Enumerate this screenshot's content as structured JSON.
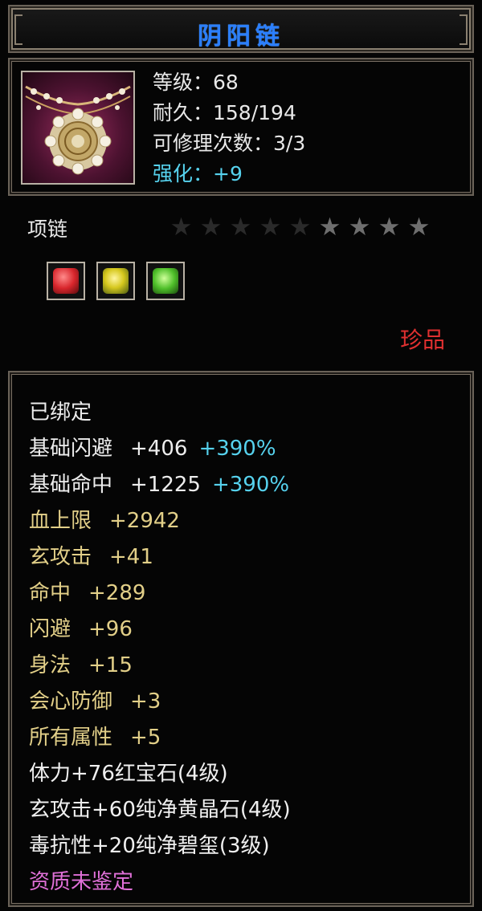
{
  "item": {
    "name": "阴阳链",
    "level_text": "等级：68",
    "durability_text": "耐久：158/194",
    "repair_text": "可修理次数：3/3",
    "enhance_text": "强化：+9",
    "type": "项链",
    "rarity": "珍品",
    "stars": {
      "total": 9,
      "dim": 5,
      "lit": 4
    },
    "gem_sockets": [
      {
        "name": "red-gem-icon",
        "color": "#d8262c"
      },
      {
        "name": "yellow-gem-icon",
        "color": "#d6c81e"
      },
      {
        "name": "green-gem-icon",
        "color": "#4fbf2a"
      }
    ]
  },
  "attributes": {
    "bound": "已绑定",
    "base": [
      {
        "name": "基础闪避",
        "value": "+406",
        "pct": "+390%"
      },
      {
        "name": "基础命中",
        "value": "+1225",
        "pct": "+390%"
      }
    ],
    "bonus": [
      {
        "name": "血上限",
        "value": "+2942"
      },
      {
        "name": "玄攻击",
        "value": "+41"
      },
      {
        "name": "命中",
        "value": "+289"
      },
      {
        "name": "闪避",
        "value": "+96"
      },
      {
        "name": "身法",
        "value": "+15"
      },
      {
        "name": "会心防御",
        "value": "+3"
      },
      {
        "name": "所有属性",
        "value": "+5"
      }
    ],
    "gems": [
      "体力+76红宝石(4级)",
      "玄攻击+60纯净黄晶石(4级)",
      "毒抗性+20纯净碧玺(3级)"
    ],
    "quality": "资质未鉴定"
  },
  "colors": {
    "title": "#2b7fff",
    "enhance": "#56d2ee",
    "rarity": "#e03030",
    "bonus": "#e2cf88",
    "quality": "#e070d8"
  }
}
